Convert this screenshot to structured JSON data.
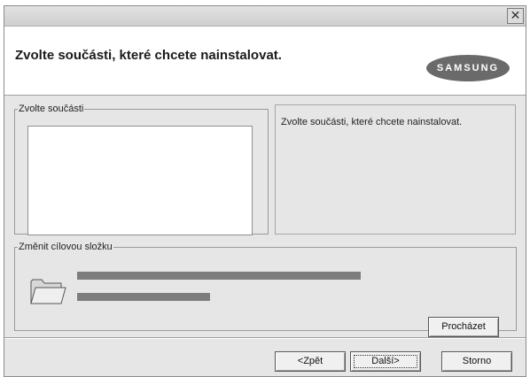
{
  "header": {
    "title": "Zvolte součásti, které chcete nainstalovat.",
    "logo_text": "SAMSUNG"
  },
  "titlebar": {
    "close_icon": "close-icon"
  },
  "components_group": {
    "legend": "Zvolte součásti",
    "description": "Zvolte součásti, které chcete nainstalovat."
  },
  "folder_group": {
    "legend": "Změnit cílovou složku",
    "folder_icon": "folder-icon",
    "browse_label": "Procházet"
  },
  "buttons": {
    "back": "<Zpět",
    "next": "Další>",
    "cancel": "Storno"
  },
  "colors": {
    "window_bg": "#e6e6e6",
    "header_bg": "#ffffff",
    "logo_bg": "#6a6a6a",
    "bar": "#7d7d7d"
  }
}
